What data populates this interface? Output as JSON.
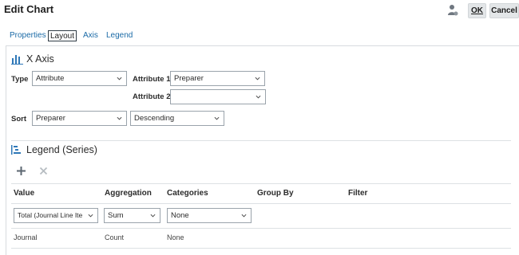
{
  "header": {
    "title": "Edit Chart",
    "ok_label": "OK",
    "cancel_label": "Cancel"
  },
  "tabs": [
    {
      "label": "Properties"
    },
    {
      "label": "Layout"
    },
    {
      "label": "Axis"
    },
    {
      "label": "Legend"
    }
  ],
  "x_axis": {
    "title": "X Axis",
    "type_label": "Type",
    "type_value": "Attribute",
    "attribute1_label": "Attribute 1",
    "attribute1_value": "Preparer",
    "attribute2_label": "Attribute 2",
    "attribute2_value": "",
    "sort_label": "Sort",
    "sort_value": "Preparer",
    "sort_order_value": "Descending"
  },
  "legend": {
    "title": "Legend (Series)",
    "columns": {
      "value": "Value",
      "aggregation": "Aggregation",
      "categories": "Categories",
      "group_by": "Group By",
      "filter": "Filter"
    },
    "rows": [
      {
        "value": "Total (Journal Line Ite",
        "aggregation": "Sum",
        "categories": "None"
      },
      {
        "value": "Journal",
        "aggregation": "Count",
        "categories": "None"
      }
    ]
  },
  "colors": {
    "accent": "#1a6aa6",
    "icon_blue": "#2f78b8"
  }
}
